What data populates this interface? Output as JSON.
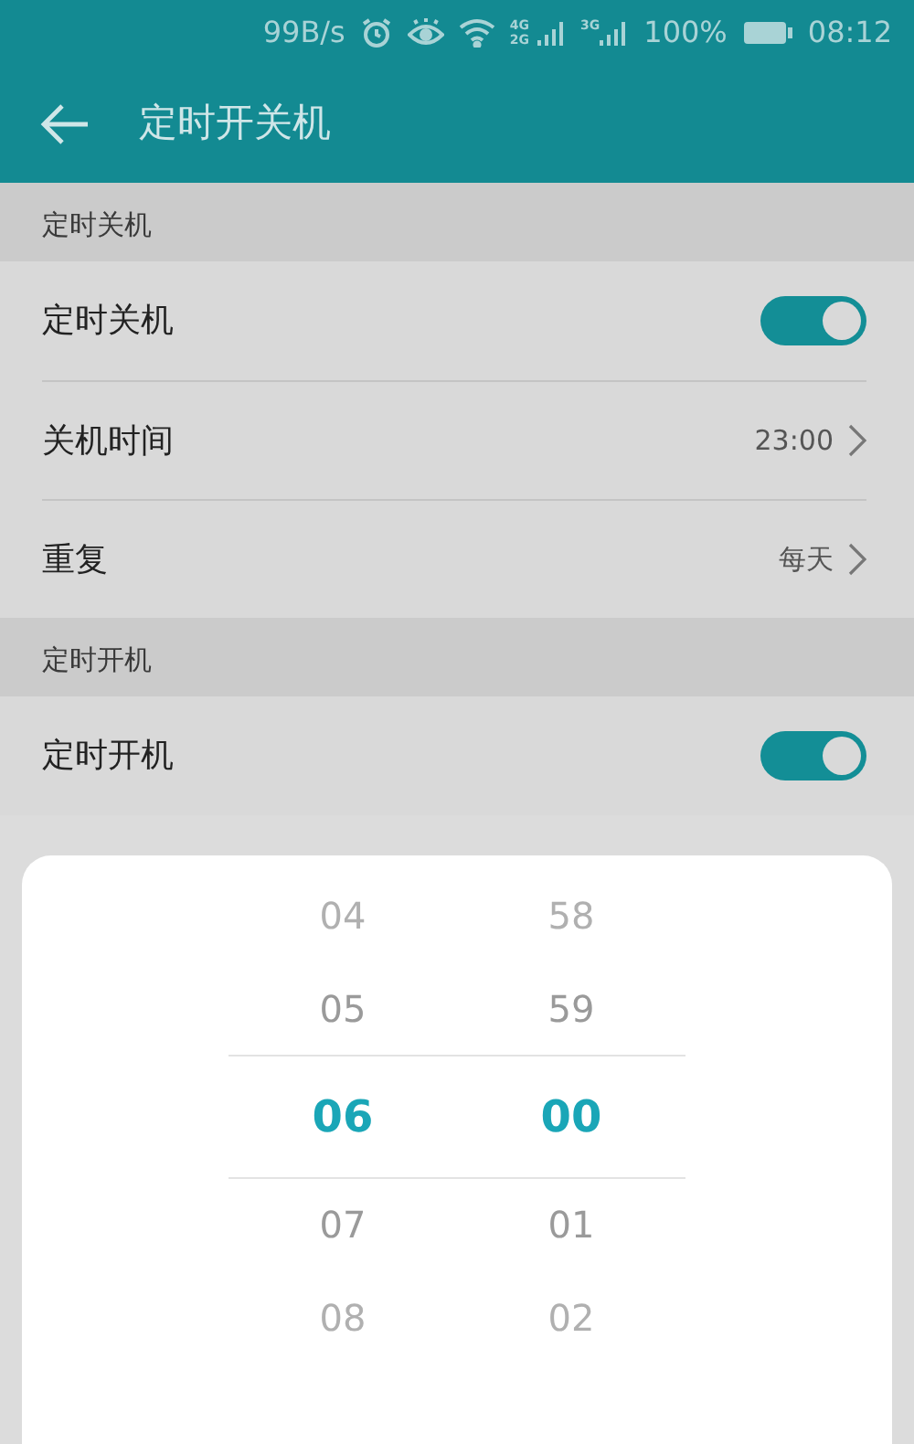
{
  "status_bar": {
    "speed": "99B/s",
    "network_1": [
      "4G",
      "2G"
    ],
    "network_2": "3G",
    "battery": "100%",
    "time": "08:12"
  },
  "header": {
    "title": "定时开关机"
  },
  "sections": [
    {
      "title": "定时关机",
      "rows": [
        {
          "kind": "switch",
          "label": "定时关机",
          "on": true
        },
        {
          "kind": "value",
          "label": "关机时间",
          "value": "23:00"
        },
        {
          "kind": "value",
          "label": "重复",
          "value": "每天"
        }
      ]
    },
    {
      "title": "定时开机",
      "rows": [
        {
          "kind": "switch",
          "label": "定时开机",
          "on": true
        }
      ]
    }
  ],
  "picker": {
    "columns": [
      {
        "items": [
          {
            "text": "04",
            "selected": false
          },
          {
            "text": "05",
            "selected": false
          },
          {
            "text": "06",
            "selected": true
          },
          {
            "text": "07",
            "selected": false
          },
          {
            "text": "08",
            "selected": false
          }
        ]
      },
      {
        "items": [
          {
            "text": "58",
            "selected": false
          },
          {
            "text": "59",
            "selected": false
          },
          {
            "text": "00",
            "selected": true
          },
          {
            "text": "01",
            "selected": false
          },
          {
            "text": "02",
            "selected": false
          }
        ]
      }
    ]
  }
}
